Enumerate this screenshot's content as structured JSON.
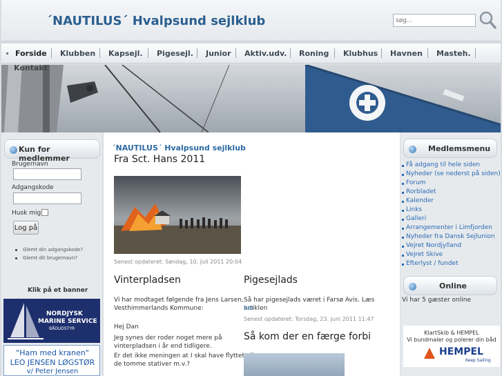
{
  "header": {
    "site_title": "´NAUTILUS´ Hvalpsund sejlklub",
    "search_placeholder": "søg..."
  },
  "nav": {
    "items": [
      {
        "label": "Forside",
        "active": true
      },
      {
        "label": "Klubben"
      },
      {
        "label": "Kapsejl."
      },
      {
        "label": "Pigesejl."
      },
      {
        "label": "Junior"
      },
      {
        "label": "Aktiv.udv."
      },
      {
        "label": "Roning"
      },
      {
        "label": "Klubhus"
      },
      {
        "label": "Havnen"
      },
      {
        "label": "Masteh."
      }
    ],
    "overflow_item": "Kontakt"
  },
  "login": {
    "heading": "Kun for medlemmer",
    "username_label": "Brugernavn",
    "password_label": "Adgangskode",
    "remember_label": "Husk mig",
    "submit_label": "Log på",
    "forgot_password": "Glemt din adgangskode?",
    "forgot_username": "Glemt dit brugernavn?"
  },
  "banners": {
    "heading": "Klik på et banner",
    "nordjysk": {
      "line1": "NORDJYSK",
      "line2": "MARINE SERVICE",
      "line3": "BÅDUDSTYR"
    },
    "kranen": {
      "line1": "\"Ham med kranen\"",
      "line2": "LEO JENSEN LØGSTØR",
      "line3": "v/ Peter Jensen"
    }
  },
  "article": {
    "site_name": "´NAUTILUS´ Hvalpsund sejlklub",
    "title": "Fra Sct. Hans 2011",
    "updated": "Senest opdateret: Søndag, 10. Juli 2011 20:04"
  },
  "vinterpladsen": {
    "title": "Vinterpladsen",
    "p1": "Vi har modtaget følgende fra Jens Larsen,",
    "p1b": "Vesthimmerlands Kommune:",
    "p2": "Hej Dan",
    "p3": "Jeg synes der roder noget mere på",
    "p3b": "vinterpladsen i år end tidligere.",
    "p4": "Er det ikke meningen at I skal have flyttet alle",
    "p4b": "de tomme stativer m.v.?"
  },
  "pigesejlads": {
    "title": "Pigesejlads",
    "p1": "Så har pigesejlads været i Farsø Avis. Læs artiklen",
    "link": "her",
    "updated": "Senest opdateret: Torsdag, 23. juni 2011 11:47"
  },
  "faerge": {
    "title": "Så kom der en færge forbi"
  },
  "member_menu": {
    "heading": "Medlemsmenu",
    "items": [
      "Få adgang til hele siden",
      "Nyheder (se nederst på siden)",
      "Forum",
      "Rorbladet",
      "Kalender",
      "Links",
      "Galleri",
      "Arrangementer i Limfjorden",
      "Nyheder fra Dansk Sejlunion",
      "Vejret Nordjylland",
      "Vejret Skive",
      "Efterlyst / fundet"
    ]
  },
  "online": {
    "heading": "Online",
    "text": "Vi har 5 gæster online"
  },
  "hempel_ad": {
    "line1": "KlartSkib & HEMPEL",
    "line2": "Vi bundmaler og polerer din båd",
    "brand": "HEMPEL",
    "tagline": "Keep Sailing"
  },
  "colors": {
    "brand_blue": "#2b5f8f",
    "link_blue": "#2a6ab3",
    "flag_blue": "#2f5b8e"
  }
}
